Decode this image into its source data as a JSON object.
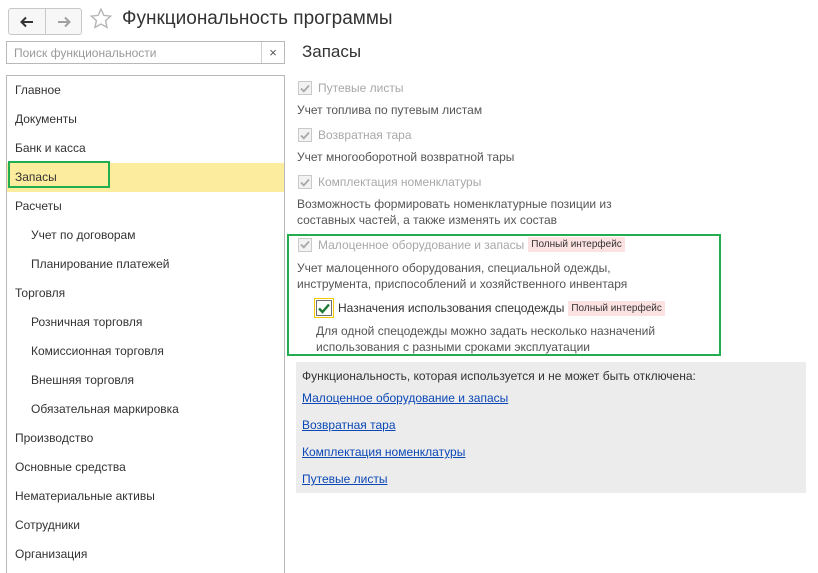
{
  "window": {
    "title": "Функциональность программы",
    "back_icon": "arrow-left-icon",
    "forward_icon": "arrow-right-icon",
    "favorite_icon": "star-outline-icon"
  },
  "search": {
    "placeholder": "Поиск функциональности",
    "value": "",
    "clear_label": "×"
  },
  "sidebar": {
    "items": [
      {
        "label": "Главное"
      },
      {
        "label": "Документы"
      },
      {
        "label": "Банк и касса"
      },
      {
        "label": "Запасы"
      },
      {
        "label": "Расчеты"
      },
      {
        "label": "Учет по договорам"
      },
      {
        "label": "Планирование платежей"
      },
      {
        "label": "Торговля"
      },
      {
        "label": "Розничная торговля"
      },
      {
        "label": "Комиссионная торговля"
      },
      {
        "label": "Внешняя торговля"
      },
      {
        "label": "Обязательная маркировка"
      },
      {
        "label": "Производство"
      },
      {
        "label": "Основные средства"
      },
      {
        "label": "Нематериальные активы"
      },
      {
        "label": "Сотрудники"
      },
      {
        "label": "Организация"
      }
    ],
    "active_index": 3
  },
  "main": {
    "title": "Запасы",
    "options": [
      {
        "label": "Путевые листы",
        "checked": true,
        "enabled": false,
        "description": "Учет топлива по путевым листам"
      },
      {
        "label": "Возвратная тара",
        "checked": true,
        "enabled": false,
        "description": "Учет многооборотной возвратной тары"
      },
      {
        "label": "Комплектация номенклатуры",
        "checked": true,
        "enabled": false,
        "description_line1": "Возможность формировать номенклатурные позиции из",
        "description_line2": "составных частей, а также изменять их состав"
      },
      {
        "label": "Малоценное оборудование и запасы",
        "checked": true,
        "enabled": false,
        "badge": "Полный интерфейс",
        "description_line1": "Учет малоценного оборудования, специальной одежды,",
        "description_line2": "инструмента, приспособлений и хозяйственного инвентаря"
      },
      {
        "label": "Назначения использования спецодежды",
        "checked": true,
        "enabled": true,
        "badge": "Полный интерфейс",
        "description_line1": "Для одной спецодежды можно задать несколько назначений",
        "description_line2": "использования с разными сроками эксплуатации"
      }
    ],
    "locked_panel": {
      "title": "Функциональность, которая используется и не может быть отключена:",
      "links": [
        "Малоценное оборудование и запасы",
        "Возвратная тара",
        "Комплектация номенклатуры",
        "Путевые листы"
      ]
    }
  },
  "colors": {
    "highlight_border": "#22ad4f",
    "active_item_bg": "#fbec9e",
    "link": "#0b48b6",
    "badge_bg": "#fde2e2",
    "panel_bg": "#ececec"
  }
}
